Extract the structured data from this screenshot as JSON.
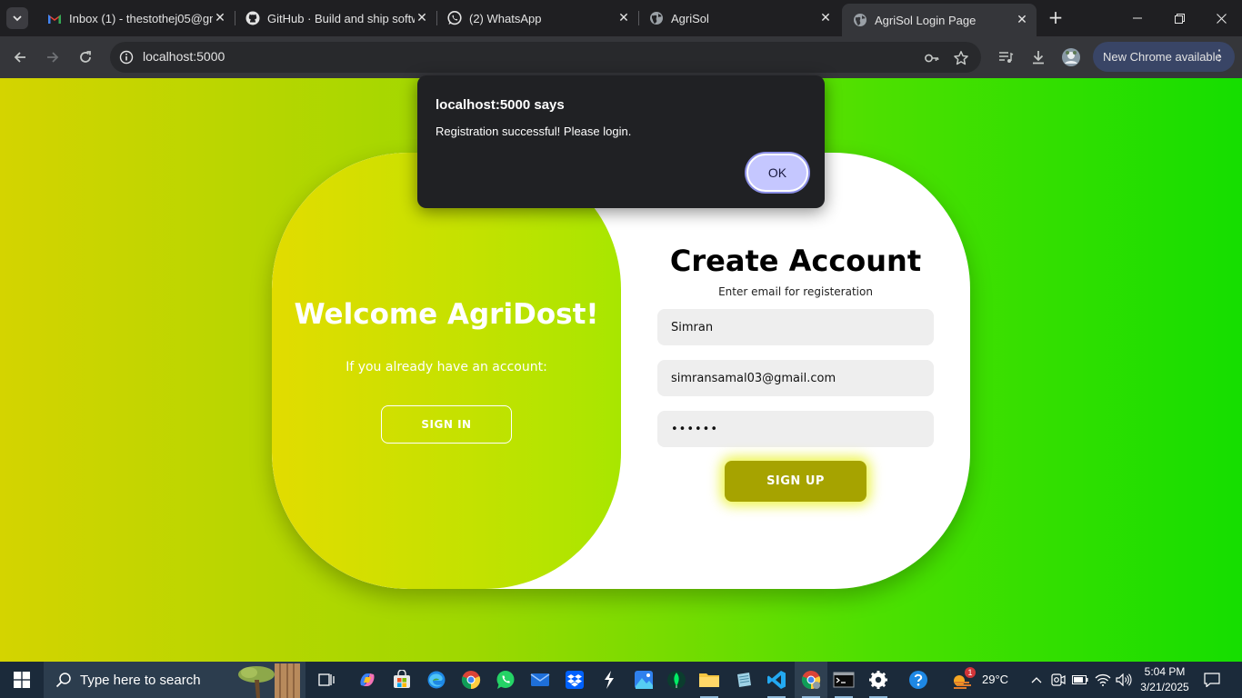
{
  "browser": {
    "tabs": [
      {
        "title": "Inbox (1) - thestothej05@gm",
        "favicon": "gmail-icon",
        "active": false
      },
      {
        "title": "GitHub · Build and ship softw",
        "favicon": "github-icon",
        "active": false
      },
      {
        "title": "(2) WhatsApp",
        "favicon": "whatsapp-icon",
        "active": false
      },
      {
        "title": "AgriSol",
        "favicon": "globe-icon",
        "active": false
      },
      {
        "title": "AgriSol Login Page",
        "favicon": "globe-icon",
        "active": true
      }
    ],
    "address": "localhost:5000",
    "update_label": "New Chrome available"
  },
  "dialog": {
    "title": "localhost:5000 says",
    "message": "Registration successful! Please login.",
    "ok_label": "OK"
  },
  "welcome_panel": {
    "heading": "Welcome AgriDost!",
    "subtext": "If you already have an account:",
    "signin_label": "SIGN IN"
  },
  "register_form": {
    "heading": "Create Account",
    "subtext": "Enter email for registeration",
    "name_value": "Simran",
    "email_value": "simransamal03@gmail.com",
    "password_value": "••••••",
    "signup_label": "SIGN UP"
  },
  "taskbar": {
    "search_placeholder": "Type here to search",
    "weather": "29°C",
    "time": "5:04 PM",
    "date": "3/21/2025",
    "notification_badge": "1"
  },
  "colors": {
    "brand_yellow": "#d4d400",
    "brand_green": "#15de00",
    "signup_button": "#a6a300",
    "dialog_ok": "#c5c7ff"
  }
}
